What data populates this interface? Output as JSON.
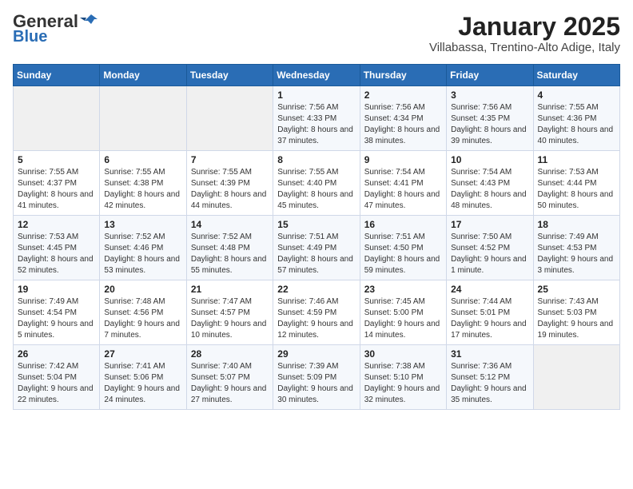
{
  "header": {
    "logo_general": "General",
    "logo_blue": "Blue",
    "title": "January 2025",
    "subtitle": "Villabassa, Trentino-Alto Adige, Italy"
  },
  "calendar": {
    "days_of_week": [
      "Sunday",
      "Monday",
      "Tuesday",
      "Wednesday",
      "Thursday",
      "Friday",
      "Saturday"
    ],
    "weeks": [
      [
        {
          "day": "",
          "info": ""
        },
        {
          "day": "",
          "info": ""
        },
        {
          "day": "",
          "info": ""
        },
        {
          "day": "1",
          "info": "Sunrise: 7:56 AM\nSunset: 4:33 PM\nDaylight: 8 hours and 37 minutes."
        },
        {
          "day": "2",
          "info": "Sunrise: 7:56 AM\nSunset: 4:34 PM\nDaylight: 8 hours and 38 minutes."
        },
        {
          "day": "3",
          "info": "Sunrise: 7:56 AM\nSunset: 4:35 PM\nDaylight: 8 hours and 39 minutes."
        },
        {
          "day": "4",
          "info": "Sunrise: 7:55 AM\nSunset: 4:36 PM\nDaylight: 8 hours and 40 minutes."
        }
      ],
      [
        {
          "day": "5",
          "info": "Sunrise: 7:55 AM\nSunset: 4:37 PM\nDaylight: 8 hours and 41 minutes."
        },
        {
          "day": "6",
          "info": "Sunrise: 7:55 AM\nSunset: 4:38 PM\nDaylight: 8 hours and 42 minutes."
        },
        {
          "day": "7",
          "info": "Sunrise: 7:55 AM\nSunset: 4:39 PM\nDaylight: 8 hours and 44 minutes."
        },
        {
          "day": "8",
          "info": "Sunrise: 7:55 AM\nSunset: 4:40 PM\nDaylight: 8 hours and 45 minutes."
        },
        {
          "day": "9",
          "info": "Sunrise: 7:54 AM\nSunset: 4:41 PM\nDaylight: 8 hours and 47 minutes."
        },
        {
          "day": "10",
          "info": "Sunrise: 7:54 AM\nSunset: 4:43 PM\nDaylight: 8 hours and 48 minutes."
        },
        {
          "day": "11",
          "info": "Sunrise: 7:53 AM\nSunset: 4:44 PM\nDaylight: 8 hours and 50 minutes."
        }
      ],
      [
        {
          "day": "12",
          "info": "Sunrise: 7:53 AM\nSunset: 4:45 PM\nDaylight: 8 hours and 52 minutes."
        },
        {
          "day": "13",
          "info": "Sunrise: 7:52 AM\nSunset: 4:46 PM\nDaylight: 8 hours and 53 minutes."
        },
        {
          "day": "14",
          "info": "Sunrise: 7:52 AM\nSunset: 4:48 PM\nDaylight: 8 hours and 55 minutes."
        },
        {
          "day": "15",
          "info": "Sunrise: 7:51 AM\nSunset: 4:49 PM\nDaylight: 8 hours and 57 minutes."
        },
        {
          "day": "16",
          "info": "Sunrise: 7:51 AM\nSunset: 4:50 PM\nDaylight: 8 hours and 59 minutes."
        },
        {
          "day": "17",
          "info": "Sunrise: 7:50 AM\nSunset: 4:52 PM\nDaylight: 9 hours and 1 minute."
        },
        {
          "day": "18",
          "info": "Sunrise: 7:49 AM\nSunset: 4:53 PM\nDaylight: 9 hours and 3 minutes."
        }
      ],
      [
        {
          "day": "19",
          "info": "Sunrise: 7:49 AM\nSunset: 4:54 PM\nDaylight: 9 hours and 5 minutes."
        },
        {
          "day": "20",
          "info": "Sunrise: 7:48 AM\nSunset: 4:56 PM\nDaylight: 9 hours and 7 minutes."
        },
        {
          "day": "21",
          "info": "Sunrise: 7:47 AM\nSunset: 4:57 PM\nDaylight: 9 hours and 10 minutes."
        },
        {
          "day": "22",
          "info": "Sunrise: 7:46 AM\nSunset: 4:59 PM\nDaylight: 9 hours and 12 minutes."
        },
        {
          "day": "23",
          "info": "Sunrise: 7:45 AM\nSunset: 5:00 PM\nDaylight: 9 hours and 14 minutes."
        },
        {
          "day": "24",
          "info": "Sunrise: 7:44 AM\nSunset: 5:01 PM\nDaylight: 9 hours and 17 minutes."
        },
        {
          "day": "25",
          "info": "Sunrise: 7:43 AM\nSunset: 5:03 PM\nDaylight: 9 hours and 19 minutes."
        }
      ],
      [
        {
          "day": "26",
          "info": "Sunrise: 7:42 AM\nSunset: 5:04 PM\nDaylight: 9 hours and 22 minutes."
        },
        {
          "day": "27",
          "info": "Sunrise: 7:41 AM\nSunset: 5:06 PM\nDaylight: 9 hours and 24 minutes."
        },
        {
          "day": "28",
          "info": "Sunrise: 7:40 AM\nSunset: 5:07 PM\nDaylight: 9 hours and 27 minutes."
        },
        {
          "day": "29",
          "info": "Sunrise: 7:39 AM\nSunset: 5:09 PM\nDaylight: 9 hours and 30 minutes."
        },
        {
          "day": "30",
          "info": "Sunrise: 7:38 AM\nSunset: 5:10 PM\nDaylight: 9 hours and 32 minutes."
        },
        {
          "day": "31",
          "info": "Sunrise: 7:36 AM\nSunset: 5:12 PM\nDaylight: 9 hours and 35 minutes."
        },
        {
          "day": "",
          "info": ""
        }
      ]
    ]
  }
}
